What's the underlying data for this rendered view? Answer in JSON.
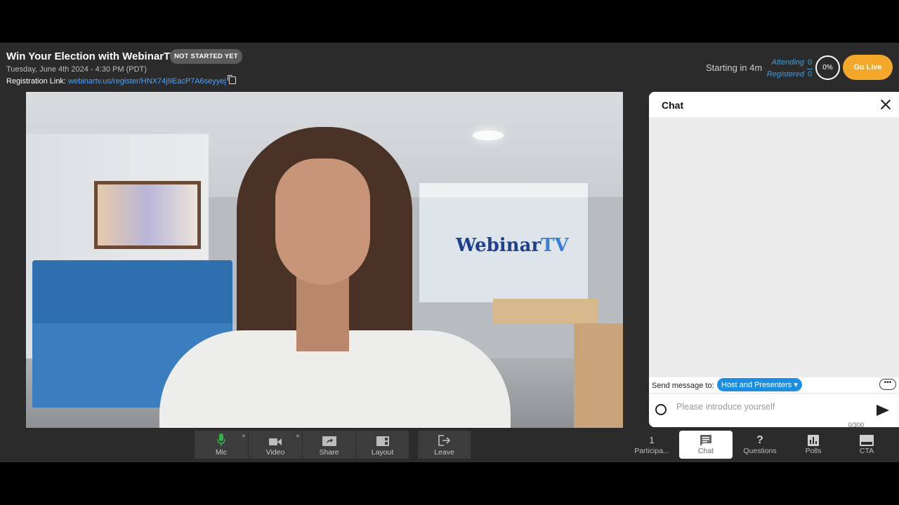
{
  "header": {
    "title": "Win Your Election with WebinarTV",
    "status_badge": "NOT STARTED YET",
    "date": "Tuesday, June 4th 2024 - 4:30 PM (PDT)",
    "registration_label": "Registration Link: ",
    "registration_url": "webinartv.us/register/HNX74j9EacP7A6seyyej",
    "starting_text": "Starting in 4m",
    "attending_label": "Attending",
    "attending_count": "0",
    "registered_label": "Registered",
    "registered_count": "0",
    "attendance_percent": "0%",
    "go_live_label": "Go Live"
  },
  "video": {
    "brand_left": "Webinar",
    "brand_right": "TV"
  },
  "controls": [
    {
      "label": "Mic",
      "icon": "mic-icon"
    },
    {
      "label": "Video",
      "icon": "video-camera-icon"
    },
    {
      "label": "Share",
      "icon": "share-icon"
    },
    {
      "label": "Layout",
      "icon": "layout-icon"
    },
    {
      "label": "Leave",
      "icon": "leave-icon"
    }
  ],
  "chat": {
    "title": "Chat",
    "send_to_label": "Send message to:",
    "send_to_value": "Host and Presenters",
    "more_label": "•••",
    "input_placeholder": "Please introduce yourself",
    "char_counter": "0/300"
  },
  "tabs": [
    {
      "label": "Participa...",
      "icon": "1"
    },
    {
      "label": "Chat",
      "icon": "chat-icon"
    },
    {
      "label": "Questions",
      "icon": "?"
    },
    {
      "label": "Polls",
      "icon": "polls-icon"
    },
    {
      "label": "CTA",
      "icon": "cta-icon"
    }
  ],
  "colors": {
    "accent_blue": "#1a8fe6",
    "go_live": "#f3a829",
    "mic_green": "#2fb44a"
  }
}
